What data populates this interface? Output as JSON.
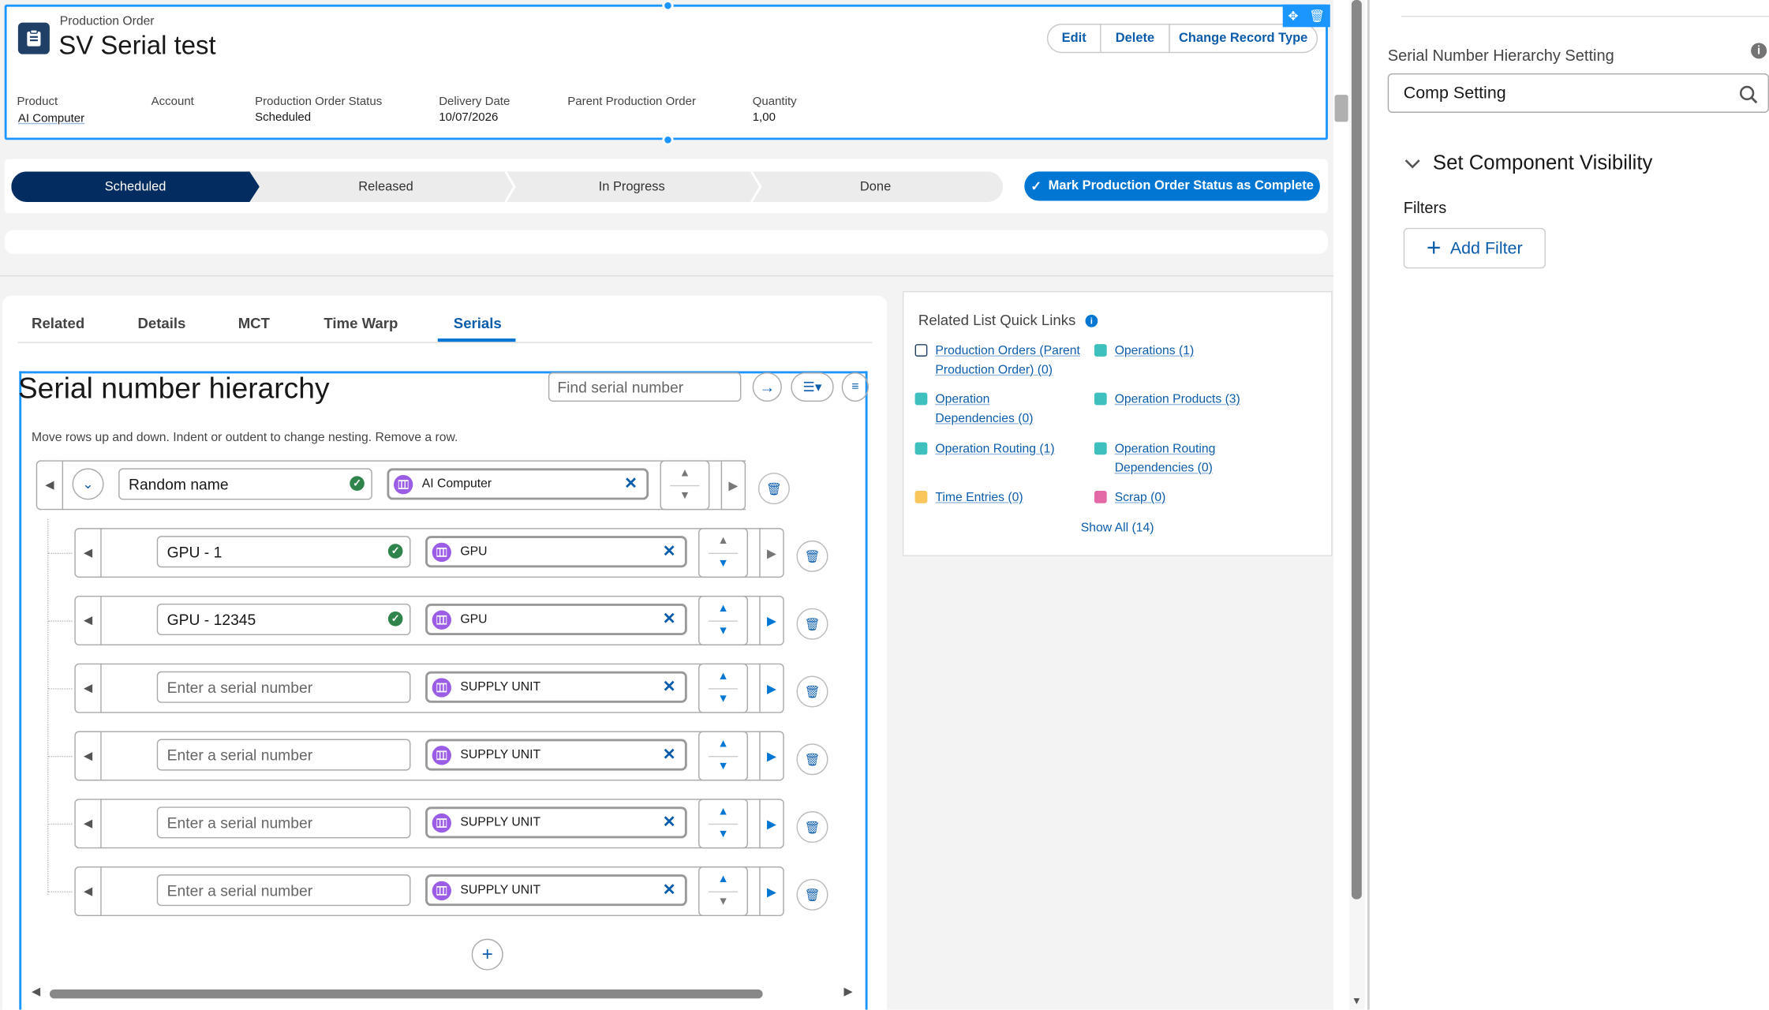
{
  "record": {
    "object_label": "Production Order",
    "title": "SV Serial test",
    "actions": {
      "edit": "Edit",
      "delete": "Delete",
      "change_record_type": "Change Record Type"
    },
    "fields": {
      "product_label": "Product",
      "product_value": "AI Computer",
      "account_label": "Account",
      "status_label": "Production Order Status",
      "status_value": "Scheduled",
      "delivery_label": "Delivery Date",
      "delivery_value": "10/07/2026",
      "parent_label": "Parent Production Order",
      "quantity_label": "Quantity",
      "quantity_value": "1,00"
    }
  },
  "path": {
    "stages": [
      "Scheduled",
      "Released",
      "In Progress",
      "Done"
    ],
    "active_index": 0,
    "complete_button": "Mark Production Order Status as Complete"
  },
  "tabs": {
    "items": [
      "Related",
      "Details",
      "MCT",
      "Time Warp",
      "Serials"
    ],
    "active": "Serials"
  },
  "hierarchy": {
    "title": "Serial number hierarchy",
    "search_placeholder": "Find serial number",
    "instructions": "Move rows up and down. Indent or outdent to change nesting. Remove a row.",
    "root": {
      "serial": "Random name",
      "product": "AI Computer"
    },
    "children": [
      {
        "serial": "GPU - 1",
        "product": "GPU",
        "has_value": true
      },
      {
        "serial": "GPU - 12345",
        "product": "GPU",
        "has_value": true
      },
      {
        "serial": "Enter a serial number",
        "product": "SUPPLY UNIT",
        "has_value": false
      },
      {
        "serial": "Enter a serial number",
        "product": "SUPPLY UNIT",
        "has_value": false
      },
      {
        "serial": "Enter a serial number",
        "product": "SUPPLY UNIT",
        "has_value": false
      },
      {
        "serial": "Enter a serial number",
        "product": "SUPPLY UNIT",
        "has_value": false
      }
    ]
  },
  "quick_links": {
    "title": "Related List Quick Links",
    "links": {
      "production_orders": "Production Orders (Parent Production Order) (0)",
      "operations": "Operations (1)",
      "operation_dependencies": "Operation Dependencies (0)",
      "operation_products": "Operation Products (3)",
      "operation_routing": "Operation Routing (1)",
      "operation_routing_dependencies": "Operation Routing Dependencies (0)",
      "time_entries": "Time Entries (0)",
      "scrap": "Scrap (0)"
    },
    "show_all": "Show All (14)"
  },
  "properties": {
    "setting_label": "Serial Number Hierarchy Setting",
    "setting_value": "Comp Setting",
    "section_title": "Set Component Visibility",
    "filters_label": "Filters",
    "add_filter": "Add Filter"
  },
  "colors": {
    "brand": "#0176d3",
    "navy": "#032d60",
    "link": "#0b5cab",
    "success": "#2e844a",
    "purple": "#9b5ce6"
  }
}
